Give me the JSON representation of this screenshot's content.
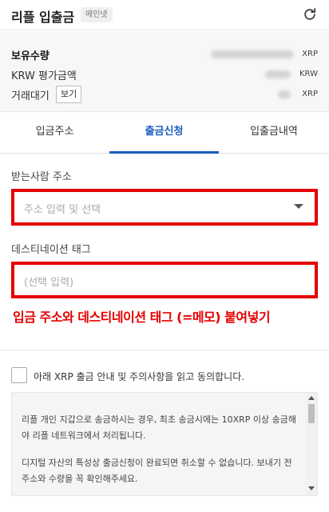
{
  "header": {
    "title": "리플 입출금",
    "badge": "메인넷",
    "refresh_icon": "refresh-icon"
  },
  "balance": {
    "holdings_label": "보유수량",
    "holdings_unit": "XRP",
    "krw_label": "KRW 평가금액",
    "krw_unit": "KRW",
    "pending_label": "거래대기",
    "view_button": "보기",
    "pending_unit": "XRP"
  },
  "tabs": [
    {
      "label": "입금주소",
      "active": false
    },
    {
      "label": "출금신청",
      "active": true
    },
    {
      "label": "입출금내역",
      "active": false
    }
  ],
  "form": {
    "address_label": "받는사람 주소",
    "address_placeholder": "주소 입력 및 선택",
    "tag_label": "데스티네이션 태그",
    "tag_placeholder": "(선택 입력)"
  },
  "annotation": "입금 주소와 데스티네이션 태그 (=메모) 붙여넣기",
  "agree_label": "아래 XRP 출금 안내 및 주의사항을 읽고 동의합니다.",
  "notice": {
    "paragraph_1": "리플 개인 지갑으로 송금하시는 경우, 최초 송금시에는 10XRP 이상 송금해야 리플 네트워크에서 처리됩니다.",
    "paragraph_2": "디지털 자산의 특성상 출금신청이 완료되면 취소할 수 없습니다. 보내기 전 주소와 수량을 꼭 확인해주세요."
  },
  "colors": {
    "accent": "#1a5bbf",
    "highlight": "#e60000"
  }
}
